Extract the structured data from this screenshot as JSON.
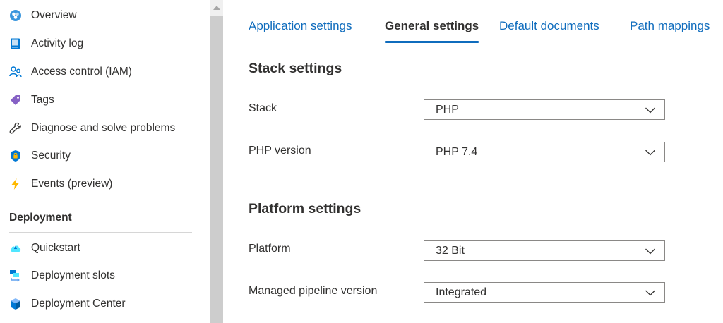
{
  "sidebar": {
    "items": [
      {
        "label": "Overview",
        "icon": "overview-icon"
      },
      {
        "label": "Activity log",
        "icon": "activity-log-icon"
      },
      {
        "label": "Access control (IAM)",
        "icon": "access-control-icon"
      },
      {
        "label": "Tags",
        "icon": "tag-icon"
      },
      {
        "label": "Diagnose and solve problems",
        "icon": "wrench-icon"
      },
      {
        "label": "Security",
        "icon": "shield-icon"
      },
      {
        "label": "Events (preview)",
        "icon": "lightning-icon"
      }
    ],
    "deployment_header": "Deployment",
    "deployment_items": [
      {
        "label": "Quickstart",
        "icon": "quickstart-icon"
      },
      {
        "label": "Deployment slots",
        "icon": "deployment-slots-icon"
      },
      {
        "label": "Deployment Center",
        "icon": "cube-icon"
      }
    ]
  },
  "tabs": [
    {
      "label": "Application settings",
      "active": false
    },
    {
      "label": "General settings",
      "active": true
    },
    {
      "label": "Default documents",
      "active": false
    },
    {
      "label": "Path mappings",
      "active": false
    }
  ],
  "stack_settings": {
    "title": "Stack settings",
    "stack": {
      "label": "Stack",
      "value": "PHP"
    },
    "php_version": {
      "label": "PHP version",
      "value": "PHP 7.4"
    }
  },
  "platform_settings": {
    "title": "Platform settings",
    "platform": {
      "label": "Platform",
      "value": "32 Bit"
    },
    "pipeline": {
      "label": "Managed pipeline version",
      "value": "Integrated"
    }
  },
  "colors": {
    "accent": "#0f6cbd",
    "text": "#323130",
    "border": "#8a8886"
  }
}
